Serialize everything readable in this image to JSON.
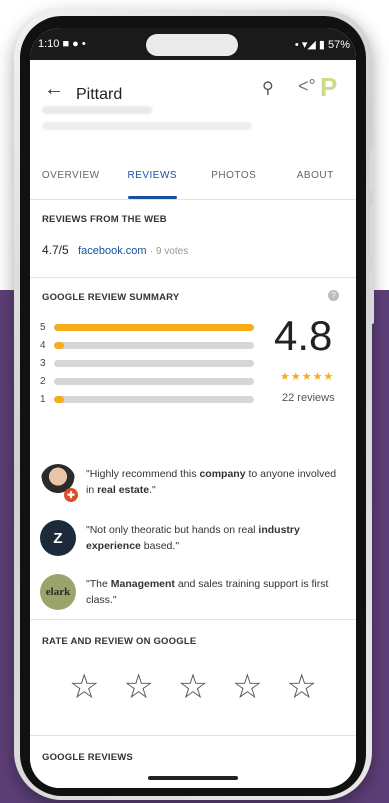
{
  "status": {
    "time": "1:10",
    "battery": "57%"
  },
  "appbar": {
    "title": "Pittard"
  },
  "tabs": [
    {
      "label": "OVERVIEW"
    },
    {
      "label": "REVIEWS"
    },
    {
      "label": "PHOTOS"
    },
    {
      "label": "ABOUT"
    }
  ],
  "web_reviews": {
    "heading": "REVIEWS FROM THE WEB",
    "score": "4.7/5",
    "source": "facebook.com",
    "votes": "· 9 votes"
  },
  "summary": {
    "heading": "GOOGLE REVIEW SUMMARY",
    "rating": "4.8",
    "stars": "★★★★★",
    "count": "22 reviews",
    "distribution": [
      {
        "label": "5",
        "fraction": 1.0
      },
      {
        "label": "4",
        "fraction": 0.05
      },
      {
        "label": "3",
        "fraction": 0.0
      },
      {
        "label": "2",
        "fraction": 0.0
      },
      {
        "label": "1",
        "fraction": 0.05
      }
    ]
  },
  "snippets": [
    {
      "avatar": "",
      "pre": "\"Highly recommend this ",
      "bold": "company",
      "mid": " to anyone involved in ",
      "bold2": "real estate",
      "post": ".\""
    },
    {
      "avatar": "Z",
      "pre": "\"Not only theoratic but hands on real ",
      "bold": "industry experience",
      "mid": " based.\"",
      "bold2": "",
      "post": ""
    },
    {
      "avatar": "elark",
      "pre": "\"The ",
      "bold": "Management",
      "mid": " and sales training support is first class.\"",
      "bold2": "",
      "post": ""
    }
  ],
  "rate": {
    "heading": "RATE AND REVIEW ON GOOGLE",
    "star": "☆"
  },
  "google_reviews": {
    "heading": "GOOGLE REVIEWS"
  }
}
